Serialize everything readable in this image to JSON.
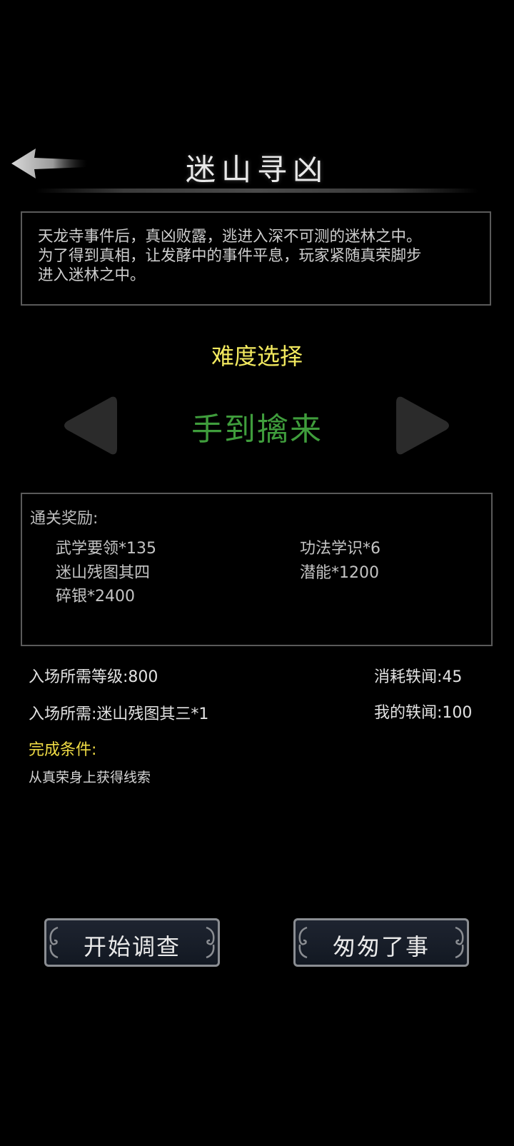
{
  "header": {
    "title": "迷山寻凶",
    "back_icon": "back-arrow-icon"
  },
  "description": {
    "lines": [
      "天龙寺事件后，真凶败露，逃进入深不可测的迷林之中。",
      "为了得到真相，让发酵中的事件平息，玩家紧随真荣脚步",
      "进入迷林之中。"
    ]
  },
  "difficulty": {
    "label": "难度选择",
    "value": "手到擒来",
    "prev_icon": "triangle-left-icon",
    "next_icon": "triangle-right-icon",
    "value_color": "#3f9d3c"
  },
  "rewards": {
    "label": "通关奖励:",
    "items": [
      "武学要领*135",
      "功法学识*6",
      "迷山残图其四",
      "潜能*1200",
      "碎银*2400"
    ]
  },
  "requirements": {
    "level": "入场所需等级:800",
    "item": "入场所需:迷山残图其三*1",
    "cost": "消耗轶闻:45",
    "owned": "我的轶闻:100"
  },
  "completion": {
    "label": "完成条件:",
    "text": "从真荣身上获得线索"
  },
  "buttons": {
    "start": "开始调查",
    "quick": "匆匆了事"
  },
  "colors": {
    "background": "#000000",
    "accent_yellow": "#f3ea5f",
    "border": "#5a5a5a"
  }
}
